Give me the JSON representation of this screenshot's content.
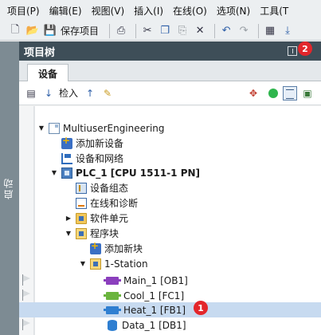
{
  "menubar": {
    "items": [
      "项目(P)",
      "编辑(E)",
      "视图(V)",
      "插入(I)",
      "在线(O)",
      "选项(N)",
      "工具(T"
    ]
  },
  "toolbar": {
    "save_project": "保存项目"
  },
  "sidebar": {
    "start_label": "启动"
  },
  "project_tree": {
    "title": "项目树",
    "badge_2": "2"
  },
  "tabs": {
    "devices": "设备"
  },
  "subtoolbar": {
    "checkin": "检入"
  },
  "tree": {
    "rows": [
      {
        "label": "MultiuserEngineering"
      },
      {
        "label": "添加新设备"
      },
      {
        "label": "设备和网络"
      },
      {
        "label": "PLC_1 [CPU 1511-1 PN]"
      },
      {
        "label": "设备组态"
      },
      {
        "label": "在线和诊断"
      },
      {
        "label": "软件单元"
      },
      {
        "label": "程序块"
      },
      {
        "label": "添加新块"
      },
      {
        "label": "1-Station"
      },
      {
        "label": "Main_1 [OB1]"
      },
      {
        "label": "Cool_1 [FC1]"
      },
      {
        "label": "Heat_1 [FB1]"
      },
      {
        "label": "Data_1 [DB1]"
      }
    ],
    "badge_1": "1"
  }
}
